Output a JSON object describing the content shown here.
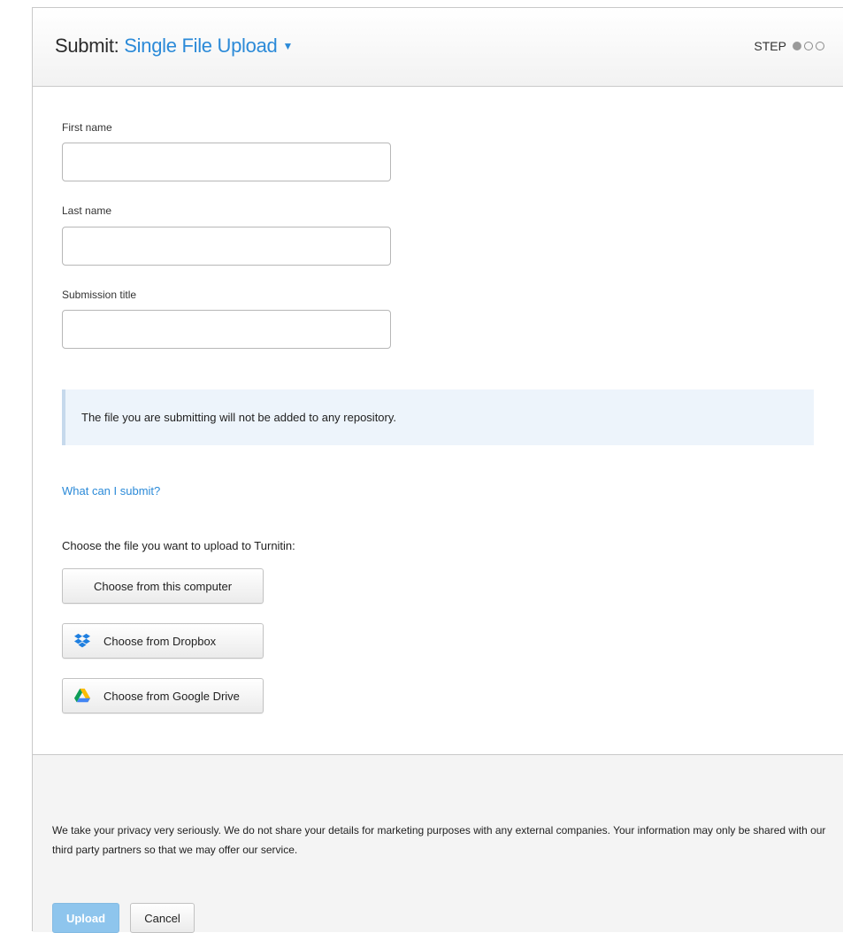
{
  "header": {
    "title_prefix": "Submit: ",
    "title_mode": "Single File Upload",
    "step_label": "STEP",
    "step_current": 1,
    "step_total": 3
  },
  "form": {
    "first_name": {
      "label": "First name",
      "value": "",
      "placeholder": ""
    },
    "last_name": {
      "label": "Last name",
      "value": "",
      "placeholder": ""
    },
    "submission_title": {
      "label": "Submission title",
      "value": "",
      "placeholder": ""
    }
  },
  "notice": "The file you are submitting will not be added to any repository.",
  "what_can_i_submit": "What can I submit?",
  "choose_label": "Choose the file you want to upload to Turnitin:",
  "buttons": {
    "computer": "Choose from this computer",
    "dropbox": "Choose from Dropbox",
    "google_drive": "Choose from Google Drive"
  },
  "footer": {
    "privacy": "We take your privacy very seriously. We do not share your details for marketing purposes with any external companies. Your information may only be shared with our third party partners so that we may offer our service.",
    "upload": "Upload",
    "cancel": "Cancel"
  },
  "colors": {
    "accent": "#2b8ad8",
    "notice_bg": "#edf4fb",
    "upload_disabled": "#8ec5ed",
    "dropbox": "#1e7fe0"
  }
}
